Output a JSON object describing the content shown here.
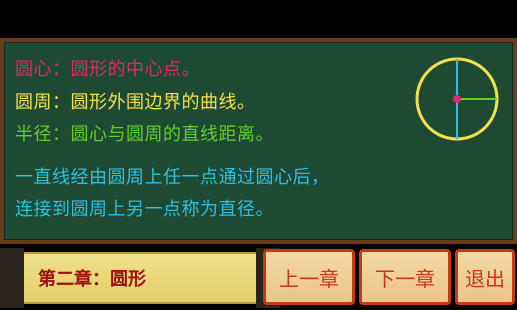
{
  "board": {
    "lines": [
      {
        "text": "圆心：圆形的中心点。",
        "color": "#e0286a"
      },
      {
        "text": "圆周：圆形外围边界的曲线。",
        "color": "#f0e24a"
      },
      {
        "text": "半径：圆心与圆周的直线距离。",
        "color": "#5fd02a"
      },
      {
        "text": "一直线经由圆周上任一点通过圆心后，",
        "color": "#2ec0e0"
      },
      {
        "text": "连接到圆周上另一点称为直径。",
        "color": "#2ec0e0"
      }
    ]
  },
  "chapter": {
    "title": "第二章：圆形"
  },
  "buttons": {
    "prev": "上一章",
    "next": "下一章",
    "exit": "退出"
  },
  "colors": {
    "board": "#1e4a34",
    "frame": "#6b3c18",
    "circumference": "#f0e24a",
    "center": "#e0286a",
    "radius": "#5fd02a",
    "diameter": "#2ec0e0",
    "button_border": "#c53a14"
  }
}
